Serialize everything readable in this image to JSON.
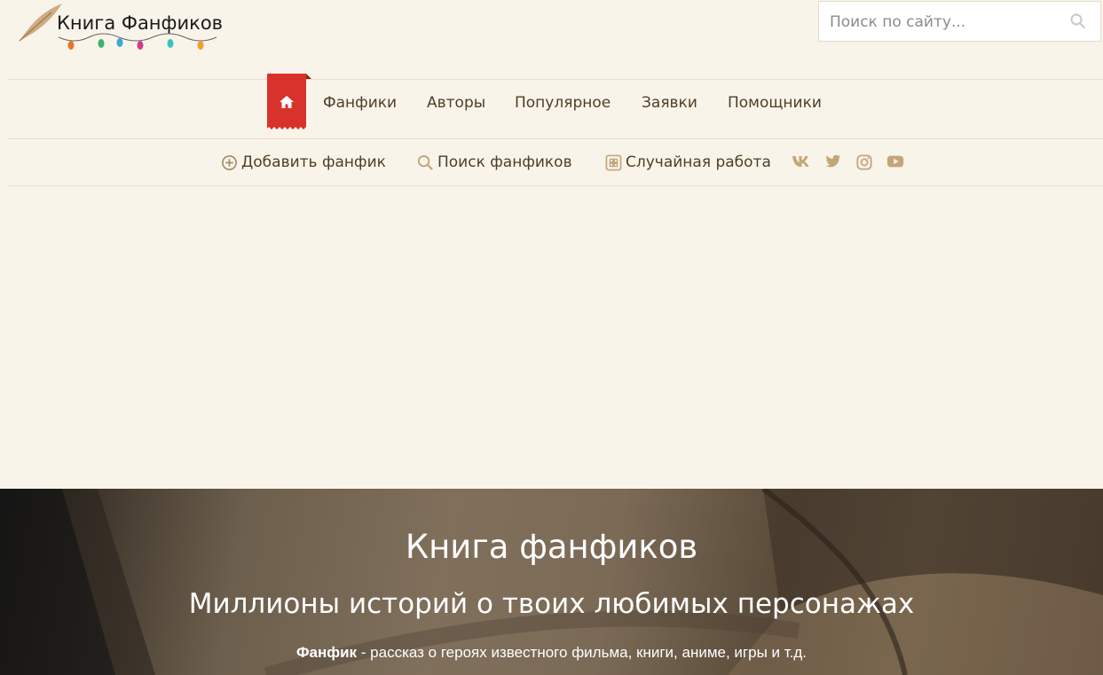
{
  "header": {
    "logo_text": "Книга Фанфиков",
    "search_placeholder": "Поиск по сайту..."
  },
  "nav": {
    "items": [
      {
        "label": "Фанфики"
      },
      {
        "label": "Авторы"
      },
      {
        "label": "Популярное"
      },
      {
        "label": "Заявки"
      },
      {
        "label": "Помощники"
      }
    ]
  },
  "subnav": {
    "add_label": "Добавить фанфик",
    "search_label": "Поиск фанфиков",
    "random_label": "Случайная работа"
  },
  "hero": {
    "title": "Книга фанфиков",
    "subtitle": "Миллионы историй о твоих любимых персонажах",
    "desc_bold": "Фанфик",
    "desc_rest": " - рассказ о героях известного фильма, книги, аниме, игры и т.д."
  },
  "colors": {
    "background": "#f9f4ea",
    "accent_red": "#d9322b",
    "nav_text": "#4f3e26",
    "icon_tan": "#c4a57a"
  }
}
